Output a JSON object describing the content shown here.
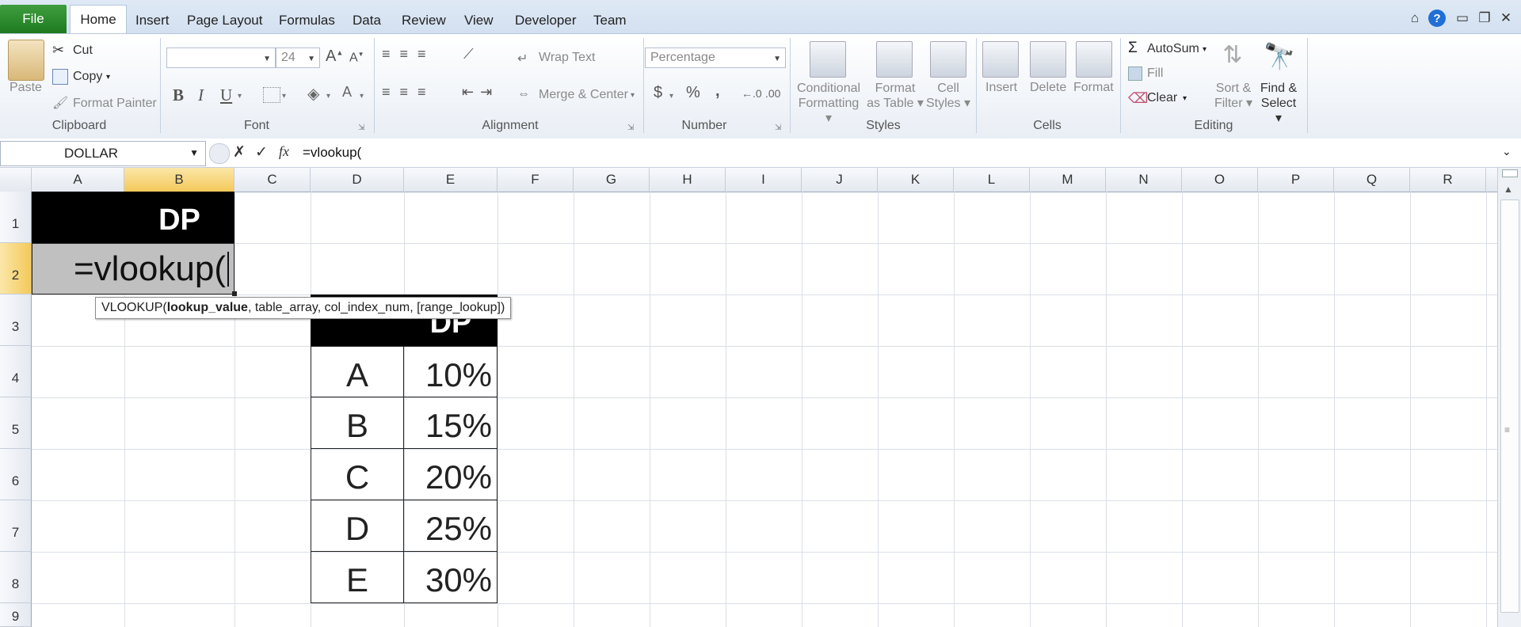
{
  "tabs": {
    "file": "File",
    "items": [
      "Home",
      "Insert",
      "Page Layout",
      "Formulas",
      "Data",
      "Review",
      "View",
      "Developer",
      "Team"
    ]
  },
  "clipboard": {
    "paste": "Paste",
    "cut": "Cut",
    "copy": "Copy",
    "format_painter": "Format Painter",
    "label": "Clipboard"
  },
  "font": {
    "name": "",
    "size": "24",
    "bold": "B",
    "italic": "I",
    "underline": "U",
    "label": "Font"
  },
  "alignment": {
    "wrap": "Wrap Text",
    "merge": "Merge & Center",
    "label": "Alignment"
  },
  "number": {
    "format": "Percentage",
    "currency": "$",
    "percent": "%",
    "comma": ",",
    "label": "Number"
  },
  "styles": {
    "cond1": "Conditional",
    "cond2": "Formatting",
    "table1": "Format",
    "table2": "as Table",
    "cell1": "Cell",
    "cell2": "Styles",
    "label": "Styles"
  },
  "cells": {
    "insert": "Insert",
    "delete": "Delete",
    "format": "Format",
    "label": "Cells"
  },
  "editing": {
    "autosum": "AutoSum",
    "fill": "Fill",
    "clear": "Clear",
    "sort1": "Sort &",
    "sort2": "Filter",
    "find1": "Find &",
    "find2": "Select",
    "label": "Editing"
  },
  "formula_bar": {
    "name_box": "DOLLAR",
    "formula": "=vlookup("
  },
  "columns": [
    "A",
    "B",
    "C",
    "D",
    "E",
    "F",
    "G",
    "H",
    "I",
    "J",
    "K",
    "L",
    "M",
    "N",
    "O",
    "P",
    "Q",
    "R"
  ],
  "rows": [
    "1",
    "2",
    "3",
    "4",
    "5",
    "6",
    "7",
    "8",
    "9"
  ],
  "sheet": {
    "b1_header": "DP",
    "a2_editing": "=vlookup(",
    "e3_header": "DP",
    "lookup_rows": [
      {
        "key": "A",
        "value": "10%"
      },
      {
        "key": "B",
        "value": "15%"
      },
      {
        "key": "C",
        "value": "20%"
      },
      {
        "key": "D",
        "value": "25%"
      },
      {
        "key": "E",
        "value": "30%"
      }
    ]
  },
  "tooltip": {
    "fn": "VLOOKUP(",
    "bold_arg": "lookup_value",
    "rest": ", table_array, col_index_num, [range_lookup])"
  }
}
